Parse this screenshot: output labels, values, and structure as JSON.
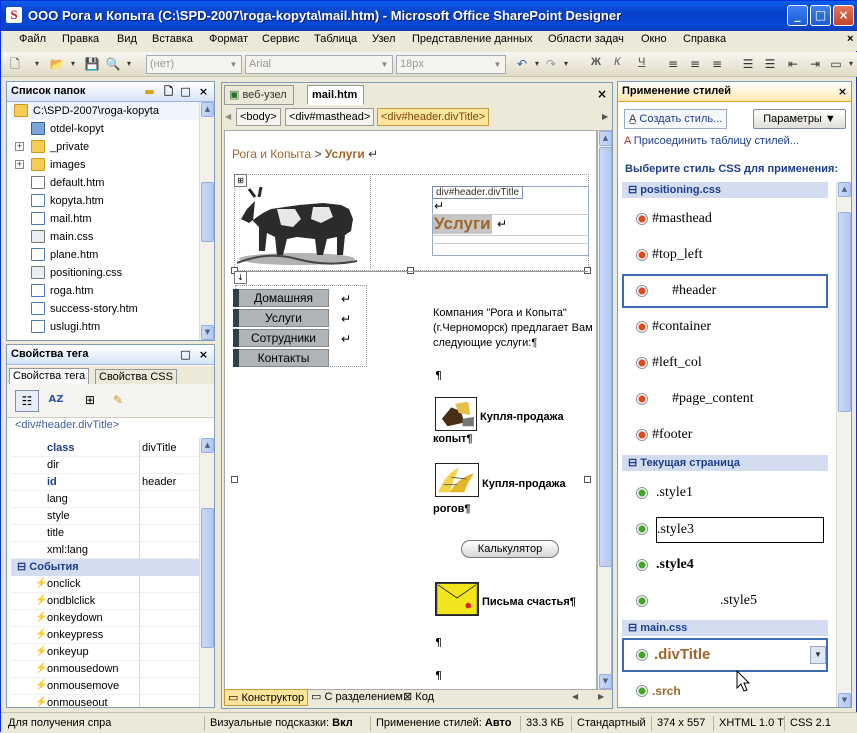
{
  "window": {
    "title": "ООО Рога и Копыта (C:\\SPD-2007\\roga-kopyta\\mail.htm) - Microsoft Office SharePoint Designer"
  },
  "menu": [
    "Файл",
    "Правка",
    "Вид",
    "Вставка",
    "Формат",
    "Сервис",
    "Таблица",
    "Узел",
    "Представление данных",
    "Области задач",
    "Окно",
    "Справка"
  ],
  "toolbar": {
    "style_value": "(нет)",
    "font_value": "Arial",
    "size_value": "18px",
    "bold": "Ж",
    "italic": "К",
    "underline": "Ч"
  },
  "folder_list": {
    "title": "Список папок",
    "root": "C:\\SPD-2007\\roga-kopyta",
    "items": [
      "otdel-kopyt",
      "_private",
      "images",
      "default.htm",
      "kopyta.htm",
      "mail.htm",
      "main.css",
      "plane.htm",
      "positioning.css",
      "roga.htm",
      "success-story.htm",
      "uslugi.htm"
    ]
  },
  "tag_props": {
    "title": "Свойства тега",
    "tab_tag": "Свойства тега",
    "tab_css": "Свойства CSS",
    "selected_tag": "<div#header.divTitle>",
    "attributes": [
      {
        "name": "class",
        "value": "divTitle"
      },
      {
        "name": "dir",
        "value": ""
      },
      {
        "name": "id",
        "value": "header"
      },
      {
        "name": "lang",
        "value": ""
      },
      {
        "name": "style",
        "value": ""
      },
      {
        "name": "title",
        "value": ""
      },
      {
        "name": "xml:lang",
        "value": ""
      }
    ],
    "events_group": "События",
    "events": [
      "onclick",
      "ondblclick",
      "onkeydown",
      "onkeypress",
      "onkeyup",
      "onmousedown",
      "onmousemove",
      "onmouseout"
    ]
  },
  "editor": {
    "tabs": [
      "веб-узел",
      "mail.htm"
    ],
    "breadcrumbs": [
      "<body>",
      "<div#masthead>",
      "<div#header.divTitle>"
    ],
    "path_text": "Рога и Копыта",
    "path_sep": ">",
    "path_current": "Услуги",
    "header_tag_label": "div#header.divTitle",
    "heading": "Услуги",
    "nav_buttons": [
      "Домашняя",
      "Услуги",
      "Сотрудники",
      "Контакты"
    ],
    "intro": "Компания \"Рога и Копыта\" (г.Черноморск) предлагает Вам следующие услуги:¶",
    "service1_a": "Купля-продажа",
    "service1_b": "копыт¶",
    "service2_a": "Купля-продажа",
    "service2_b": "рогов¶",
    "calc_button": "Калькулятор",
    "service3": "Письма счастья¶",
    "pilcrow": "¶",
    "return_mark": "↵",
    "modes": [
      "Конструктор",
      "С разделением",
      "Код"
    ]
  },
  "styles_panel": {
    "title": "Применение стилей",
    "create_style": "Создать стиль...",
    "params": "Параметры",
    "attach": "Присоединить таблицу стилей...",
    "prompt": "Выберите стиль CSS для применения:",
    "groups": [
      {
        "name": "positioning.css",
        "items": [
          "#masthead",
          "#top_left",
          "#header",
          "#container",
          "#left_col",
          "#page_content",
          "#footer"
        ]
      },
      {
        "name": "Текущая страница",
        "items": [
          ".style1",
          ".style3",
          ".style4",
          ".style5"
        ]
      },
      {
        "name": "main.css",
        "items": [
          ".divTitle",
          ".srch"
        ]
      }
    ]
  },
  "status": {
    "hint": "Для получения спра",
    "visual_hints": "Визуальные подсказки:",
    "visual_hints_val": "Вкл",
    "apply_styles": "Применение стилей:",
    "apply_styles_val": "Авто",
    "size": "33.3 КБ",
    "mode": "Стандартный",
    "dims": "374 x 557",
    "xhtml": "XHTML 1.0 T",
    "css": "CSS 2.1"
  },
  "colors": {
    "accent": "#A0662A",
    "selection": "#FFE49C",
    "panel_head": "#D6E3F7"
  }
}
